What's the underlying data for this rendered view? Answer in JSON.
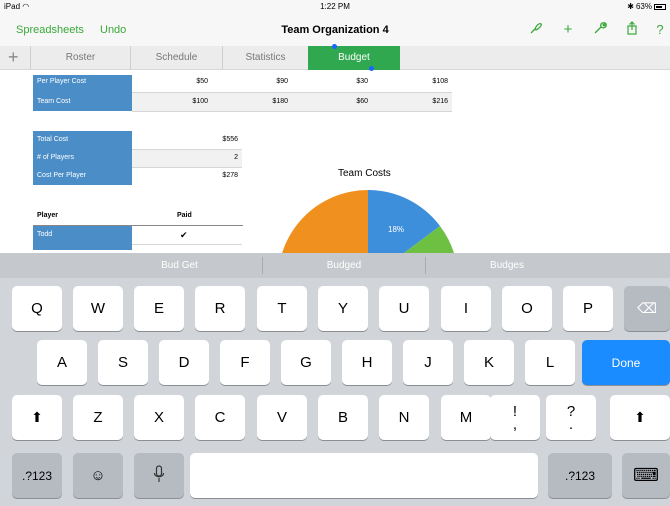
{
  "status_bar": {
    "device": "iPad",
    "time": "1:22 PM",
    "battery": "63%"
  },
  "toolbar": {
    "spreadsheets_label": "Spreadsheets",
    "undo_label": "Undo",
    "title": "Team Organization 4"
  },
  "tabs": [
    {
      "label": "Roster"
    },
    {
      "label": "Schedule"
    },
    {
      "label": "Statistics"
    },
    {
      "label": "Budget"
    }
  ],
  "cost_table": {
    "rows": [
      {
        "label": "Per Player Cost",
        "values": [
          "$50",
          "$90",
          "$30",
          "$108"
        ]
      },
      {
        "label": "Team Cost",
        "values": [
          "$100",
          "$180",
          "$60",
          "$216"
        ]
      }
    ]
  },
  "summary_table": {
    "rows": [
      {
        "label": "Total Cost",
        "value": "$556"
      },
      {
        "label": "# of Players",
        "value": "2"
      },
      {
        "label": "Cost Per Player",
        "value": "$278"
      }
    ]
  },
  "paid_table": {
    "headers": {
      "player": "Player",
      "paid": "Paid"
    },
    "rows": [
      {
        "player": "Todd",
        "paid": "✔"
      }
    ]
  },
  "chart": {
    "title": "Team Costs",
    "slice_label": "18%",
    "colors": {
      "orange": "#f0901e",
      "blue": "#3d8fdc",
      "green": "#6ec043"
    }
  },
  "suggestions": [
    "Bud Get",
    "Budged",
    "Budges"
  ],
  "keyboard": {
    "row1": [
      "Q",
      "W",
      "E",
      "R",
      "T",
      "Y",
      "U",
      "I",
      "O",
      "P"
    ],
    "row2": [
      "A",
      "S",
      "D",
      "F",
      "G",
      "H",
      "J",
      "K",
      "L"
    ],
    "row3": [
      "Z",
      "X",
      "C",
      "V",
      "B",
      "N",
      "M",
      "!",
      "?"
    ],
    "row3_sub": [
      ",",
      "."
    ],
    "done_label": "Done",
    "numbers_label": ".?123",
    "emoji_glyph": "☺",
    "mic_glyph": "🎙",
    "shift_glyph": "⬆",
    "backspace_glyph": "⌫",
    "hide_keyboard_glyph": "⌨"
  }
}
